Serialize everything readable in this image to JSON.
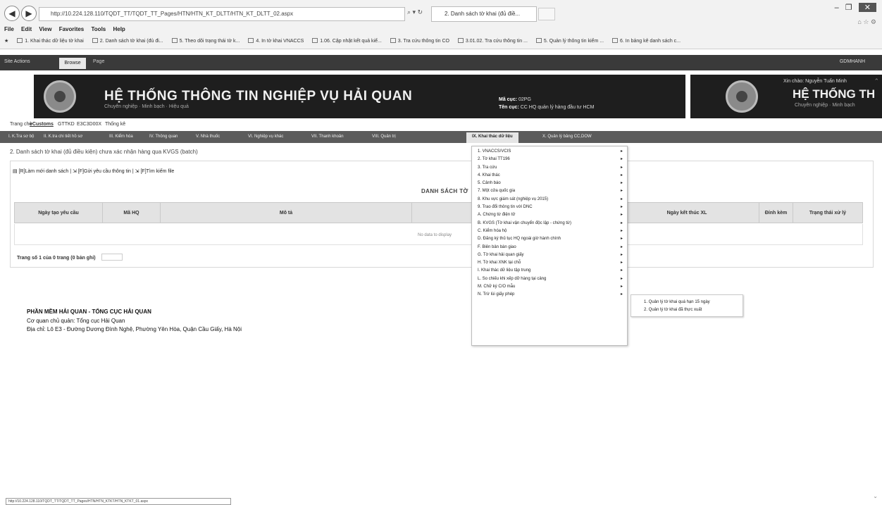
{
  "browser": {
    "address": "http://10.224.128.110/TQDT_TT/TQDT_TT_Pages/HTN/HTN_KT_DLTT/HTN_KT_DLTT_02.aspx",
    "tab_title": "2. Danh sách tờ khai (đủ điề...",
    "menu": [
      "File",
      "Edit",
      "View",
      "Favorites",
      "Tools",
      "Help"
    ],
    "favorites": [
      "1. Khai thác dữ liệu tờ khai",
      "2. Danh sách tờ khai (đủ đi...",
      "5. Theo dõi trạng thái tờ k...",
      "4. In tờ khai VNACCS",
      "1.06. Cập nhật kết quả kiể...",
      "3. Tra cứu thông tin CO",
      "3.01.02. Tra cứu thông tin ...",
      "5. Quản lý thông tin kiểm ...",
      "6. In bảng kê danh sách c..."
    ],
    "status_url": "http://10.224.128.110/TQDT_TT/TQDT_TT_Pages/HTN/HTN_KTKT/HTN_KTKT_01.aspx"
  },
  "topbar": {
    "site_actions": "Site Actions",
    "browse": "Browse",
    "page": "Page",
    "user": "GDMHANH"
  },
  "banner": {
    "title": "HỆ THỐNG THÔNG TIN NGHIỆP VỤ HẢI QUAN",
    "subtitle": "Chuyên nghiệp · Minh bạch · Hiệu quả",
    "ma_cuc_label": "Mã cục:",
    "ma_cuc_value": "02PG",
    "ten_cuc_label": "Tên cục:",
    "ten_cuc_value": "CC HQ quản lý hàng đầu tư HCM",
    "right_greeting": "Xin chào: Nguyễn Tuấn Minh",
    "right_title": "HỆ THỐNG TH",
    "right_subtitle": "Chuyên nghiệp · Minh bạch"
  },
  "module_tabs": [
    "Trang chủ",
    "eCustoms",
    "GTTKD",
    "E3C3D00X",
    "Thống kê"
  ],
  "navbar": [
    "I. K.Tra sơ bộ",
    "II. K.tra chi tiết hồ sơ",
    "III. Kiểm hóa",
    "IV. Thông quan",
    "V. Nhà thuốc",
    "VI. Nghiệp vụ khác",
    "VII. Thanh khoản",
    "VIII. Quản trị",
    "IX. Khai thác dữ liệu",
    "X. Quản lý bảng CC,DOW"
  ],
  "content": {
    "breadcrumb": "2. Danh sách tờ khai (đủ điều kiện) chưa xác nhận hàng qua KVGS (batch)",
    "actions": [
      "[R]Làm mới danh sách",
      "[F]Gửi yêu cầu thông tin",
      "[F]Tìm kiếm file"
    ],
    "list_title": "DANH SÁCH TỜ",
    "columns": [
      "Ngày tạo yêu cầu",
      "Mã HQ",
      "Mô tả",
      "",
      "Ngày kết thúc XL",
      "Đính kèm",
      "Trạng thái xử lý"
    ],
    "no_data": "No data to display",
    "pager": "Trang số 1 của 0 trang (0 bản ghi)"
  },
  "footer": {
    "title": "PHẦN MỀM HẢI QUAN - TỔNG CỤC HẢI QUAN",
    "agency": "Cơ quan chủ quản: Tổng cục Hải Quan",
    "address": "Địa chỉ: Lô E3 - Đường Dương Đình Nghệ, Phường Yên Hòa, Quận Cầu Giấy, Hà Nội"
  },
  "dropdown": [
    "1. VNACCS/VCIS",
    "2. Tờ khai TT196",
    "3. Tra cứu",
    "4. Khai thác",
    "5. Cảnh báo",
    "7. Một cửa quốc gia",
    "8. Khu vực giám sát (nghiệp vụ 2015)",
    "9. Trao đổi thông tin với DNC",
    "A. Chứng từ điện tử",
    "B. KVGS (Tờ khai vận chuyển độc lập - chứng từ)",
    "C. Kiểm hóa hộ",
    "D. Đăng ký thủ tục HQ ngoài giờ hành chính",
    "F. Biên bản bàn giao",
    "G. Tờ khai hải quan giấy",
    "H. Tờ khai XNK tại chỗ",
    "I. Khai thác dữ liệu tập trung",
    "L. So chiếu khi xếp dỡ hàng tại cảng",
    "M. Chữ ký C/O mẫu",
    "N. Trừ lùi giấy phép"
  ],
  "submenu": [
    "1. Quản lý tờ khai quá hạn 15 ngày",
    "2. Quản lý tờ khai đã thực xuất"
  ]
}
